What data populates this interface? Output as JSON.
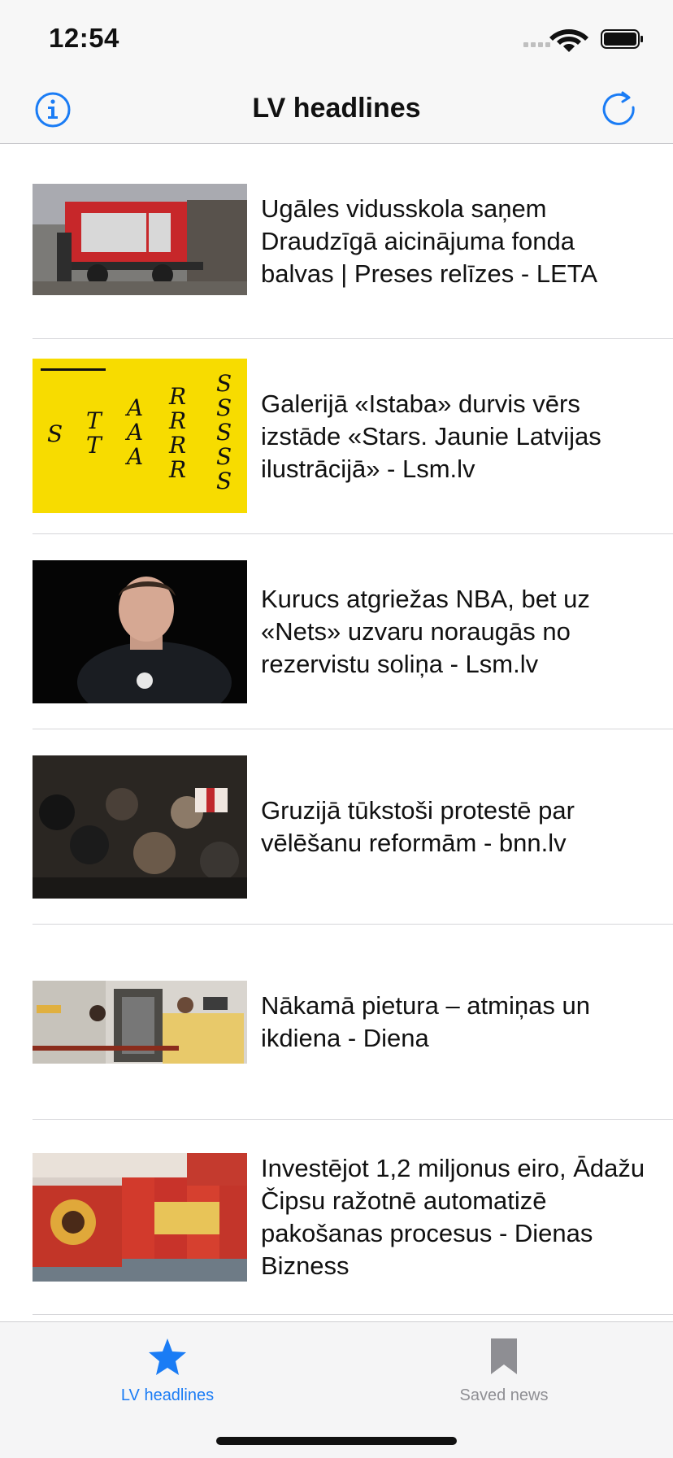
{
  "status_bar": {
    "time": "12:54"
  },
  "nav": {
    "title": "LV headlines",
    "info_icon": "info-icon",
    "refresh_icon": "refresh-icon"
  },
  "articles": [
    {
      "headline": "Ugāles vidusskola saņem Draudzīgā aicinājuma fonda balvas | Preses relīzes - LETA"
    },
    {
      "headline": "Galerijā «Istaba» durvis vērs izstāde «Stars. Jaunie Latvijas ilustrācijā» - Lsm.lv"
    },
    {
      "headline": "Kurucs atgriežas NBA, bet uz «Nets» uzvaru noraugās no rezervistu soliņa - Lsm.lv"
    },
    {
      "headline": "Gruzijā tūkstoši protestē par vēlēšanu reformām - bnn.lv"
    },
    {
      "headline": "Nākamā pietura – atmiņas un ikdiena - Diena"
    },
    {
      "headline": "Investējot 1,2 miljonus eiro, Ādažu Čipsu ražotnē automatizē pakošanas procesus - Dienas Bizness"
    }
  ],
  "tabs": [
    {
      "label": "LV headlines",
      "icon": "star-icon"
    },
    {
      "label": "Saved news",
      "icon": "bookmark-icon"
    }
  ],
  "colors": {
    "accent": "#1a7cf5",
    "inactive": "#8e8e93",
    "bar_bg": "#f7f7f7"
  }
}
